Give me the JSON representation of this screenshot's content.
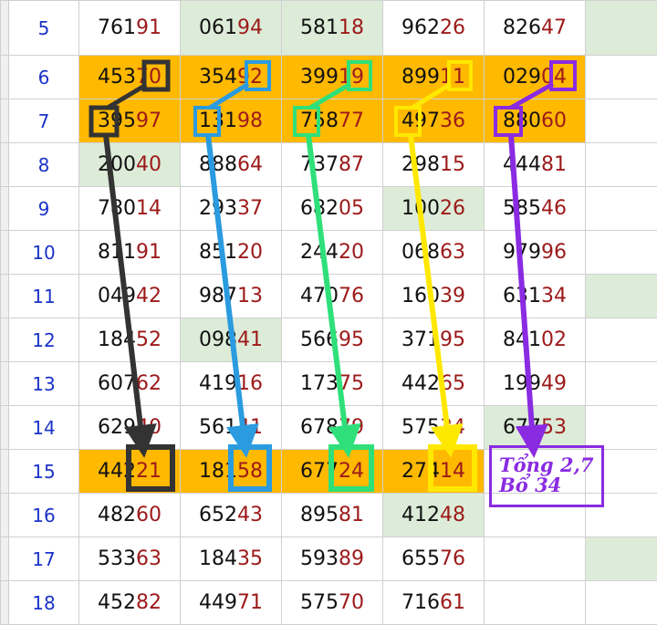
{
  "rows": [
    {
      "num": "5",
      "values": [
        "76191",
        "06194",
        "58118",
        "96226",
        "82647"
      ],
      "green": [
        1,
        2
      ]
    },
    {
      "num": "6",
      "values": [
        "45370",
        "35492",
        "39919",
        "89911",
        "02904"
      ],
      "highlight": true
    },
    {
      "num": "7",
      "values": [
        "39597",
        "13198",
        "75877",
        "49736",
        "88060"
      ],
      "highlight": true
    },
    {
      "num": "8",
      "values": [
        "20040",
        "88864",
        "73787",
        "29815",
        "44481"
      ],
      "green": [
        0
      ]
    },
    {
      "num": "9",
      "values": [
        "78014",
        "29337",
        "68205",
        "10026",
        "58546"
      ],
      "green": [
        3
      ]
    },
    {
      "num": "10",
      "values": [
        "81191",
        "85120",
        "24420",
        "06863",
        "97996"
      ]
    },
    {
      "num": "11",
      "values": [
        "04942",
        "98713",
        "47076",
        "16039",
        "63134"
      ]
    },
    {
      "num": "12",
      "values": [
        "18452",
        "09841",
        "56695",
        "37195",
        "84102"
      ],
      "green": [
        1
      ]
    },
    {
      "num": "13",
      "values": [
        "60762",
        "41916",
        "17375",
        "44265",
        "19949"
      ]
    },
    {
      "num": "14",
      "values": [
        "62940",
        "56141",
        "67879",
        "57534",
        "67753"
      ],
      "green": [
        4
      ]
    },
    {
      "num": "15",
      "values": [
        "44221",
        "18158",
        "67724",
        "27414",
        ""
      ],
      "highlight": true
    },
    {
      "num": "16",
      "values": [
        "48260",
        "65243",
        "89581",
        "41248",
        ""
      ],
      "green": [
        3
      ]
    },
    {
      "num": "17",
      "values": [
        "53363",
        "18435",
        "59389",
        "65576",
        ""
      ]
    },
    {
      "num": "18",
      "values": [
        "45282",
        "44971",
        "57570",
        "71661",
        ""
      ]
    }
  ],
  "annotation": {
    "line1": "Tổng 2,7",
    "line2": "Bổ 34"
  },
  "colors": {
    "highlight": "#ffb900",
    "green_cell": "#dcecd8",
    "row_number": "#1a33c8",
    "dark_digit": "#111111",
    "red_digit": "#9c1a1a",
    "arrow_black": "#333333",
    "arrow_blue": "#2b9be0",
    "arrow_green": "#2fe07a",
    "arrow_yellow": "#ffe800",
    "arrow_purple": "#8a2be2"
  }
}
